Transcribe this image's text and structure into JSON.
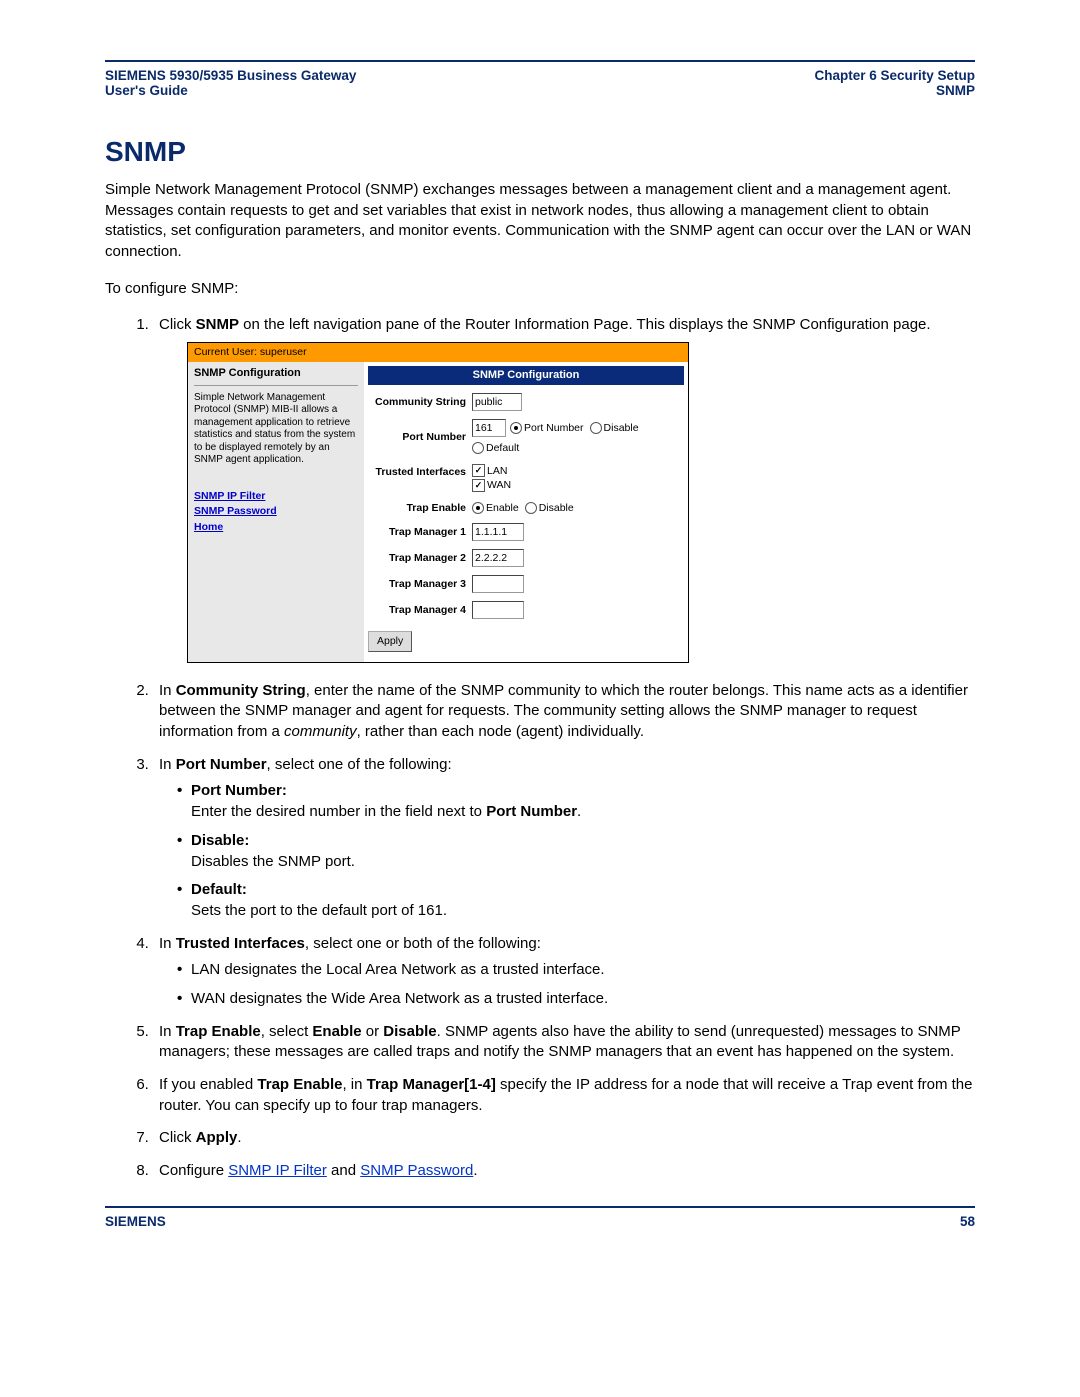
{
  "header": {
    "left_line1": "SIEMENS 5930/5935 Business Gateway",
    "left_line2": "User's Guide",
    "right_line1": "Chapter 6  Security Setup",
    "right_line2": "SNMP"
  },
  "title": "SNMP",
  "intro": "Simple Network Management Protocol (SNMP) exchanges messages between a management client and a management agent. Messages contain requests to get and set variables that exist in network nodes, thus allowing a management client to obtain statistics, set configuration parameters, and monitor events. Communication with the SNMP agent can occur over the LAN or WAN connection.",
  "lead": "To configure SNMP:",
  "steps": {
    "s1_pre": "Click ",
    "s1_bold": "SNMP",
    "s1_post": " on the left navigation pane of the Router Information Page. This displays the SNMP Configuration page.",
    "s2_pre": "In ",
    "s2_bold": "Community String",
    "s2_mid": ", enter the name of the SNMP community to which the router belongs. This name acts as a identifier between the SNMP manager and agent for requests. The community setting allows the SNMP manager to request information from a ",
    "s2_italic": "community",
    "s2_post": ", rather than each node (agent) individually.",
    "s3_pre": "In ",
    "s3_bold": "Port Number",
    "s3_post": ", select one of the following:",
    "s3_opts": {
      "pn_label": "Port Number",
      "pn_text_pre": "Enter the desired number in the field next to ",
      "pn_text_bold": "Port Number",
      "pn_text_post": ".",
      "dis_label": "Disable",
      "dis_text": "Disables the SNMP port.",
      "def_label": "Default",
      "def_text": "Sets the port to the default port of 161."
    },
    "s4_pre": "In ",
    "s4_bold": "Trusted Interfaces",
    "s4_post": ", select one or both of the following:",
    "s4_sub1": "LAN designates the Local Area Network as a trusted interface.",
    "s4_sub2": "WAN designates the Wide Area Network as a trusted interface.",
    "s5_pre": "In ",
    "s5_b1": "Trap Enable",
    "s5_mid1": ", select ",
    "s5_b2": "Enable",
    "s5_mid2": " or ",
    "s5_b3": "Disable",
    "s5_post": ". SNMP agents also have the ability to send (unrequested) messages to SNMP managers; these messages are called traps and notify the SNMP managers that an event has happened on the system.",
    "s6_pre": "If you enabled ",
    "s6_b1": "Trap Enable",
    "s6_mid1": ", in ",
    "s6_b2": "Trap Manager[1-4]",
    "s6_post": " specify the IP address for a node that will receive a Trap event from the router. You can specify up to four trap managers.",
    "s7_pre": "Click ",
    "s7_bold": "Apply",
    "s7_post": ".",
    "s8_pre": "Configure ",
    "s8_link1": "SNMP IP Filter",
    "s8_mid": " and ",
    "s8_link2": "SNMP Password",
    "s8_post": "."
  },
  "fig": {
    "user_line": "Current User: superuser",
    "left_title": "SNMP Configuration",
    "left_desc": "Simple Network Management Protocol (SNMP) MIB-II allows a management application to retrieve statistics and status from the system to be displayed remotely by an SNMP agent application.",
    "links": [
      "SNMP IP Filter",
      "SNMP Password",
      "Home"
    ],
    "panel_title": "SNMP Configuration",
    "labels": {
      "community": "Community String",
      "port": "Port Number",
      "trusted": "Trusted Interfaces",
      "trap_enable": "Trap Enable",
      "tm1": "Trap Manager 1",
      "tm2": "Trap Manager 2",
      "tm3": "Trap Manager 3",
      "tm4": "Trap Manager 4"
    },
    "values": {
      "community": "public",
      "port": "161",
      "tm1": "1.1.1.1",
      "tm2": "2.2.2.2",
      "tm3": "",
      "tm4": ""
    },
    "radios": {
      "port_number": "Port Number",
      "disable": "Disable",
      "default": "Default",
      "enable": "Enable",
      "disable2": "Disable"
    },
    "checks": {
      "lan": "LAN",
      "wan": "WAN"
    },
    "apply": "Apply"
  },
  "footer": {
    "left": "SIEMENS",
    "right": "58"
  }
}
